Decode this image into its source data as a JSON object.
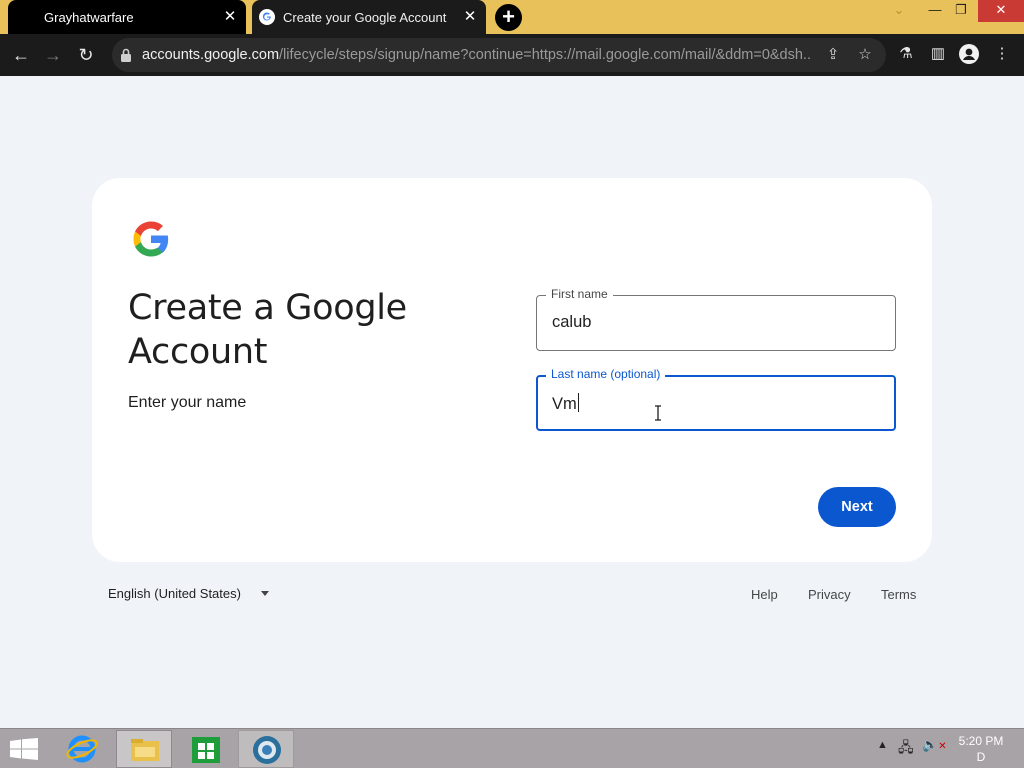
{
  "browser": {
    "tabs": [
      {
        "title": "Grayhatwarfare",
        "active": false
      },
      {
        "title": "Create your Google Account",
        "active": true
      }
    ],
    "url_domain": "accounts.google.com",
    "url_path": "/lifecycle/steps/signup/name?continue=https://mail.google.com/mail/&ddm=0&dsh...",
    "colors": {
      "tab_strip": "#e8c15a",
      "toolbar": "#1b1b1b"
    }
  },
  "signup": {
    "heading": "Create a Google Account",
    "subheading": "Enter your name",
    "first_name": {
      "label": "First name",
      "value": "calub"
    },
    "last_name": {
      "label": "Last name (optional)",
      "value": "Vm"
    },
    "next_label": "Next",
    "accent": "#0b57d0"
  },
  "footer": {
    "language": "English (United States)",
    "links": [
      "Help",
      "Privacy",
      "Terms"
    ]
  },
  "taskbar": {
    "clock_time": "5:20 PM",
    "clock_line2": "D",
    "apps": [
      "internet-explorer-icon",
      "file-explorer-icon",
      "store-icon",
      "chrome-icon"
    ]
  }
}
